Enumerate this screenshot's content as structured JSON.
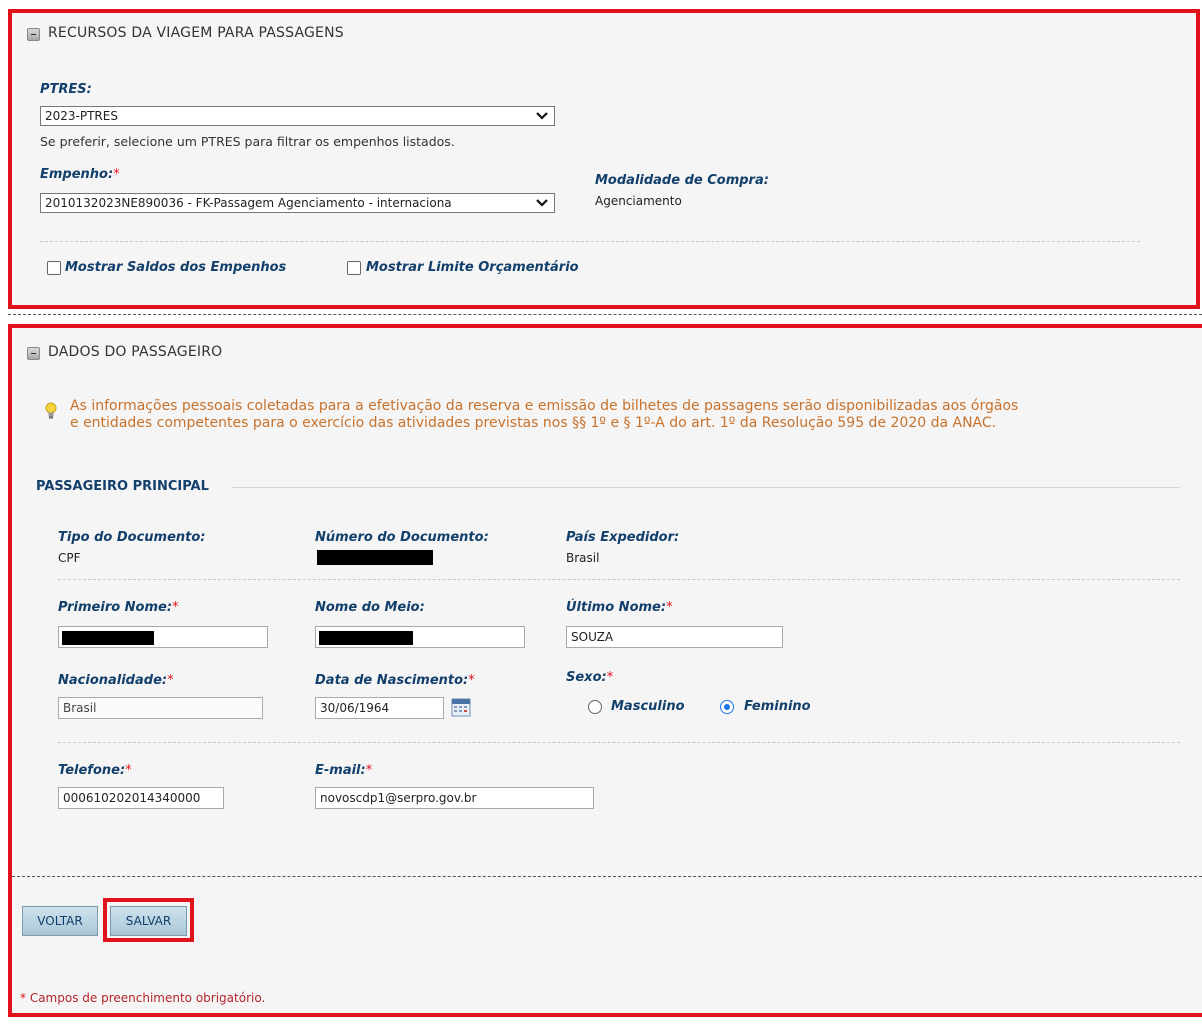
{
  "recursos": {
    "title": "RECURSOS DA VIAGEM PARA PASSAGENS",
    "ptres_label": "PTRES:",
    "ptres_value": "2023-PTRES",
    "ptres_hint": "Se preferir, selecione um PTRES para filtrar os empenhos listados.",
    "empenho_label": "Empenho:",
    "required_mark": "*",
    "empenho_value": "2010132023NE890036 - FK-Passagem Agenciamento - internaciona",
    "modalidade_label": "Modalidade de Compra:",
    "modalidade_value": "Agenciamento",
    "mostrar_saldos": "Mostrar Saldos dos Empenhos",
    "mostrar_limite": "Mostrar Limite Orçamentário"
  },
  "passageiro": {
    "title": "DADOS DO PASSAGEIRO",
    "notice_line1": "As informações pessoais coletadas para a efetivação da reserva e emissão de bilhetes de passagens serão disponibilizadas aos órgãos",
    "notice_line2": "e entidades competentes para o exercício das atividades previstas nos §§ 1º e § 1º-A do art. 1º da Resolução 595 de 2020 da ANAC.",
    "principal_heading": "PASSAGEIRO PRINCIPAL",
    "tipo_doc_label": "Tipo do Documento:",
    "tipo_doc_value": "CPF",
    "numero_doc_label": "Número do Documento:",
    "pais_label": "País Expedidor:",
    "pais_value": "Brasil",
    "primeiro_nome_label": "Primeiro Nome:",
    "nome_meio_label": "Nome do Meio:",
    "ultimo_nome_label": "Último Nome:",
    "ultimo_nome_value": "SOUZA",
    "nacionalidade_label": "Nacionalidade:",
    "nacionalidade_value": "Brasil",
    "nascimento_label": "Data de Nascimento:",
    "nascimento_value": "30/06/1964",
    "sexo_label": "Sexo:",
    "sexo_masculino": "Masculino",
    "sexo_feminino": "Feminino",
    "telefone_label": "Telefone:",
    "telefone_value": "000610202014340000",
    "email_label": "E-mail:",
    "email_value": "novoscdp1@serpro.gov.br"
  },
  "actions": {
    "voltar": "VOLTAR",
    "salvar": "SALVAR"
  },
  "footer": {
    "required_note": "Campos de preenchimento obrigatório."
  }
}
